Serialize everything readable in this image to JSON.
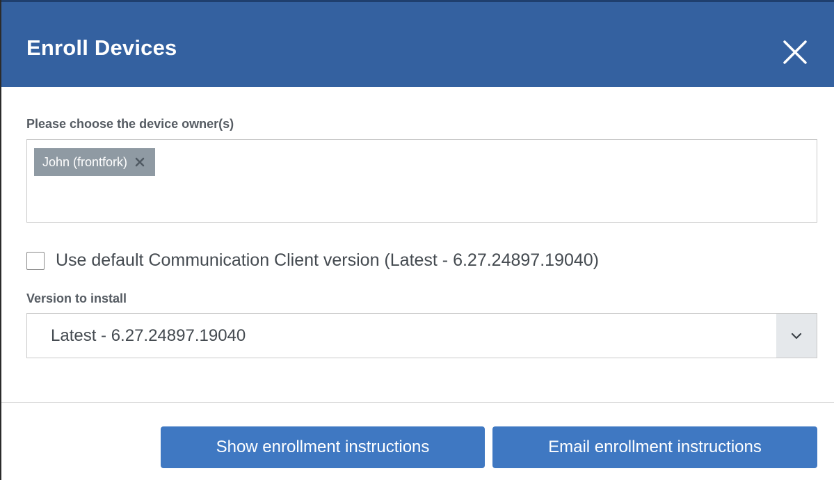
{
  "dialog": {
    "title": "Enroll Devices",
    "close_icon": "close-icon"
  },
  "owners": {
    "label": "Please choose the device owner(s)",
    "tags": [
      {
        "label": "John (frontfork)",
        "remove_icon": "remove-tag-icon"
      }
    ]
  },
  "default_version": {
    "checked": false,
    "label": "Use default Communication Client version (Latest - 6.27.24897.19040)"
  },
  "version": {
    "label": "Version to install",
    "selected": "Latest - 6.27.24897.19040",
    "arrow_icon": "chevron-down-icon"
  },
  "actions": {
    "show_label": "Show enrollment instructions",
    "email_label": "Email enrollment instructions"
  },
  "colors": {
    "header": "#3461a0",
    "button": "#3f78c2",
    "tag": "#8f9aa3"
  }
}
